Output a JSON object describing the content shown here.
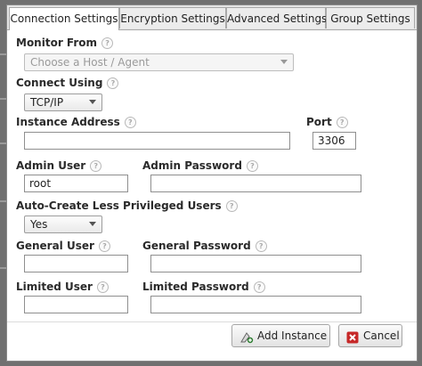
{
  "tabs": [
    {
      "label": "Connection Settings",
      "active": true
    },
    {
      "label": "Encryption Settings",
      "active": false
    },
    {
      "label": "Advanced Settings",
      "active": false
    },
    {
      "label": "Group Settings",
      "active": false
    }
  ],
  "form": {
    "monitor_from": {
      "label": "Monitor From",
      "placeholder": "Choose a Host / Agent"
    },
    "connect_using": {
      "label": "Connect Using",
      "value": "TCP/IP"
    },
    "instance_address": {
      "label": "Instance Address",
      "value": ""
    },
    "port": {
      "label": "Port",
      "value": "3306"
    },
    "admin_user": {
      "label": "Admin User",
      "value": "root"
    },
    "admin_password": {
      "label": "Admin Password",
      "value": ""
    },
    "auto_create": {
      "label": "Auto-Create Less Privileged Users",
      "value": "Yes"
    },
    "general_user": {
      "label": "General User",
      "value": ""
    },
    "general_password": {
      "label": "General Password",
      "value": ""
    },
    "limited_user": {
      "label": "Limited User",
      "value": ""
    },
    "limited_password": {
      "label": "Limited Password",
      "value": ""
    },
    "help_glyph": "?"
  },
  "buttons": {
    "add_instance": "Add Instance",
    "cancel": "Cancel"
  },
  "colors": {
    "cancel_icon": "#c62828",
    "add_icon": "#2e7d32"
  }
}
